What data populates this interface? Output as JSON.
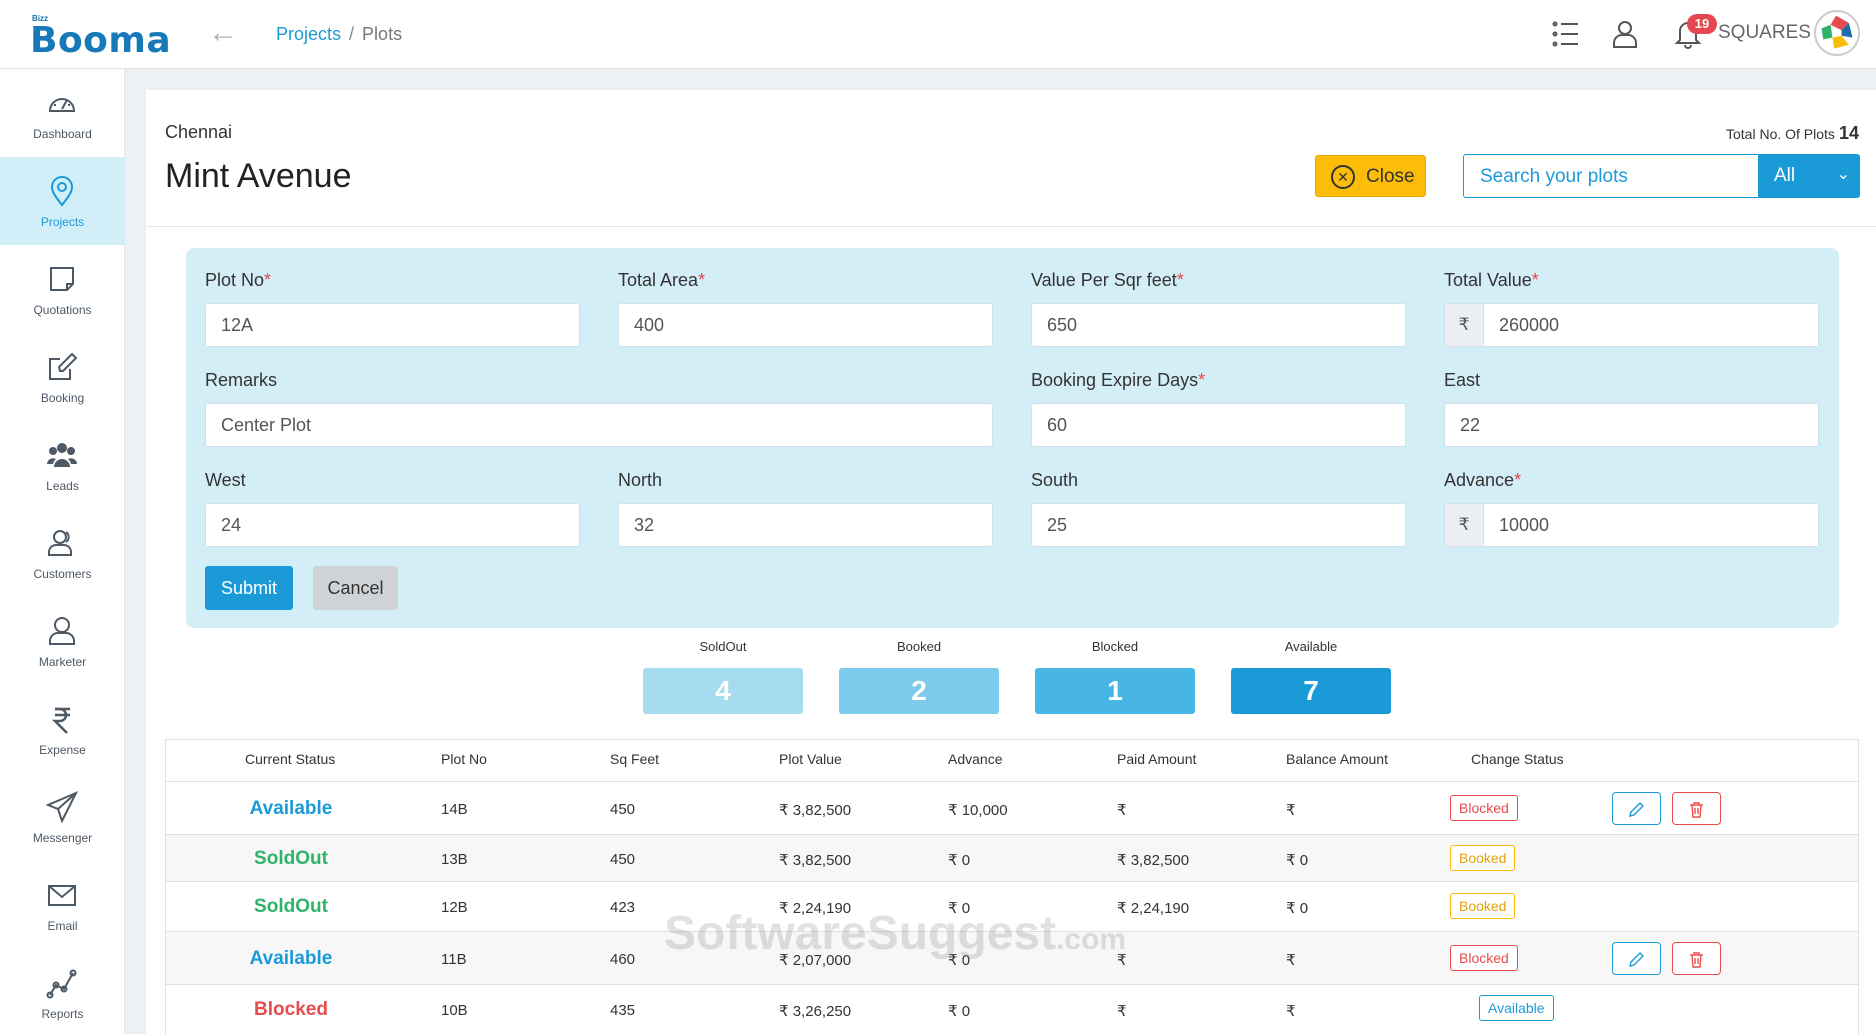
{
  "header": {
    "logo_small": "Bizz",
    "logo_text": "Booma",
    "breadcrumb": {
      "projects": "Projects",
      "separator": "/",
      "current": "Plots"
    },
    "notification_count": "19",
    "org_name": "SQUARES"
  },
  "sidebar": {
    "items": [
      {
        "label": "Dashboard",
        "icon": "gauge-icon"
      },
      {
        "label": "Projects",
        "icon": "map-pin-icon",
        "active": true
      },
      {
        "label": "Quotations",
        "icon": "note-icon"
      },
      {
        "label": "Booking",
        "icon": "edit-icon"
      },
      {
        "label": "Leads",
        "icon": "users-icon"
      },
      {
        "label": "Customers",
        "icon": "customers-icon"
      },
      {
        "label": "Marketer",
        "icon": "user-icon"
      },
      {
        "label": "Expense",
        "icon": "rupee-icon"
      },
      {
        "label": "Messenger",
        "icon": "send-icon"
      },
      {
        "label": "Email",
        "icon": "mail-icon"
      },
      {
        "label": "Reports",
        "icon": "chart-icon"
      }
    ]
  },
  "project": {
    "city": "Chennai",
    "name": "Mint Avenue",
    "total_plots_label": "Total No. Of Plots",
    "total_plots": "14",
    "close_label": "Close",
    "search_placeholder": "Search your plots",
    "filter_value": "All"
  },
  "form": {
    "plot_no": {
      "label": "Plot No",
      "value": "12A"
    },
    "total_area": {
      "label": "Total Area",
      "value": "400"
    },
    "value_per_sqft": {
      "label": "Value Per Sqr feet",
      "value": "650"
    },
    "total_value": {
      "label": "Total Value",
      "value": "260000"
    },
    "remarks": {
      "label": "Remarks",
      "value": "Center Plot"
    },
    "booking_expire": {
      "label": "Booking Expire Days",
      "value": "60"
    },
    "east": {
      "label": "East",
      "value": "22"
    },
    "west": {
      "label": "West",
      "value": "24"
    },
    "north": {
      "label": "North",
      "value": "32"
    },
    "south": {
      "label": "South",
      "value": "25"
    },
    "advance": {
      "label": "Advance",
      "value": "10000"
    },
    "currency": "₹",
    "required_mark": "*",
    "submit_label": "Submit",
    "cancel_label": "Cancel"
  },
  "counters": [
    {
      "label": "SoldOut",
      "value": "4",
      "color": "#a6dcf0"
    },
    {
      "label": "Booked",
      "value": "2",
      "color": "#7ccbea"
    },
    {
      "label": "Blocked",
      "value": "1",
      "color": "#48b6e3"
    },
    {
      "label": "Available",
      "value": "7",
      "color": "#1a9bd7"
    }
  ],
  "table": {
    "headers": [
      "Current Status",
      "Plot No",
      "Sq Feet",
      "Plot Value",
      "Advance",
      "Paid Amount",
      "Balance Amount",
      "Change Status"
    ],
    "rows": [
      {
        "status": "Available",
        "plot_no": "14B",
        "sq_feet": "450",
        "plot_value": "₹ 3,82,500",
        "advance": "₹ 10,000",
        "paid": "₹",
        "balance": "₹",
        "change": "Blocked"
      },
      {
        "status": "SoldOut",
        "plot_no": "13B",
        "sq_feet": "450",
        "plot_value": "₹ 3,82,500",
        "advance": "₹ 0",
        "paid": "₹ 3,82,500",
        "balance": "₹ 0",
        "change": "Booked"
      },
      {
        "status": "SoldOut",
        "plot_no": "12B",
        "sq_feet": "423",
        "plot_value": "₹ 2,24,190",
        "advance": "₹ 0",
        "paid": "₹ 2,24,190",
        "balance": "₹ 0",
        "change": "Booked"
      },
      {
        "status": "Available",
        "plot_no": "11B",
        "sq_feet": "460",
        "plot_value": "₹ 2,07,000",
        "advance": "₹ 0",
        "paid": "₹",
        "balance": "₹",
        "change": "Blocked"
      },
      {
        "status": "Blocked",
        "plot_no": "10B",
        "sq_feet": "435",
        "plot_value": "₹ 3,26,250",
        "advance": "₹ 0",
        "paid": "₹",
        "balance": "₹",
        "change": "Available"
      }
    ]
  },
  "watermark": {
    "main": "SoftwareSuggest",
    "suffix": ".com"
  }
}
